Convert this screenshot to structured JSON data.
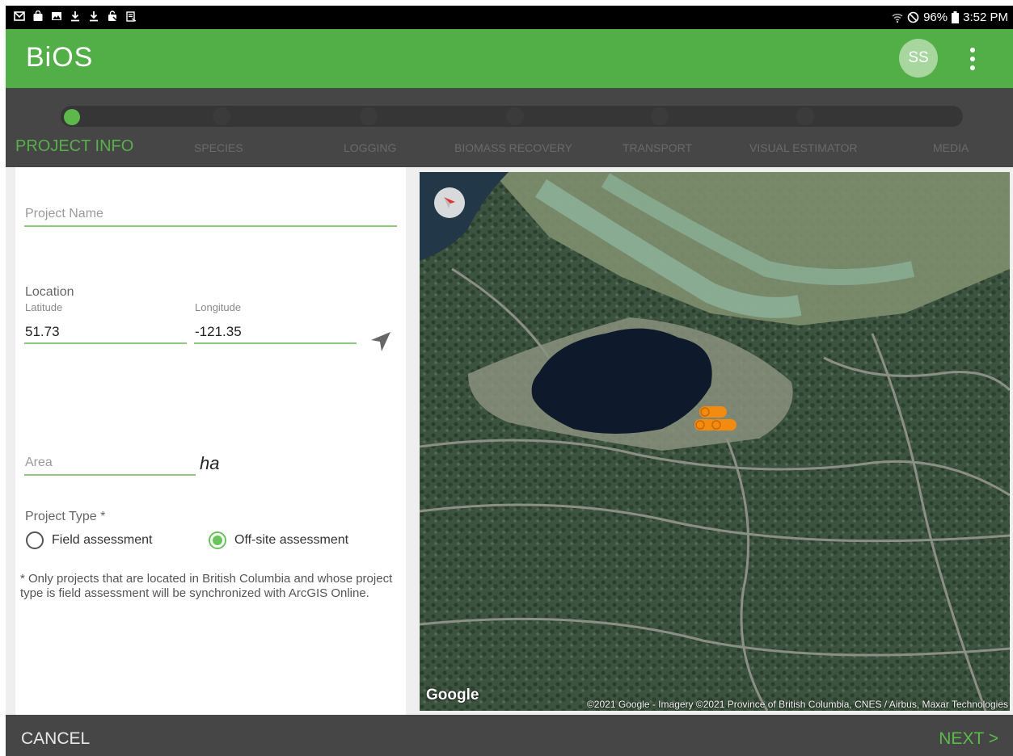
{
  "status_bar": {
    "left_icons": [
      "gmail-icon",
      "shopping-bag-icon",
      "image-icon",
      "download-icon",
      "download-icon",
      "no-sim-icon",
      "clipboard-icon"
    ],
    "battery": "96%",
    "time": "3:52 PM"
  },
  "app_bar": {
    "title": "BiOS",
    "avatar_initials": "SS"
  },
  "stepper": {
    "steps": [
      {
        "label": "PROJECT INFO",
        "active": true
      },
      {
        "label": "SPECIES",
        "active": false
      },
      {
        "label": "LOGGING",
        "active": false
      },
      {
        "label": "BIOMASS RECOVERY",
        "active": false
      },
      {
        "label": "TRANSPORT",
        "active": false
      },
      {
        "label": "VISUAL ESTIMATOR",
        "active": false
      },
      {
        "label": "MEDIA",
        "active": false
      }
    ]
  },
  "form": {
    "project_name_placeholder": "Project Name",
    "location_label": "Location",
    "latitude_label": "Latitude",
    "latitude_value": "51.73",
    "longitude_label": "Longitude",
    "longitude_value": "-121.35",
    "area_placeholder": "Area",
    "area_unit": "ha",
    "project_type_label": "Project Type *",
    "project_type_options": [
      {
        "label": "Field assessment",
        "selected": false
      },
      {
        "label": "Off-site assessment",
        "selected": true
      }
    ],
    "note": "* Only projects that are located in British Columbia and whose project type is field assessment will be synchronized with ArcGIS Online."
  },
  "map": {
    "logo": "Google",
    "attribution": "©2021 Google - Imagery ©2021 Province of British Columbia, CNES / Airbus, Maxar Technologies"
  },
  "bottom_bar": {
    "cancel_label": "CANCEL",
    "next_label": "NEXT >"
  },
  "colors": {
    "primary": "#52ae47",
    "accent": "#5bbb4a",
    "dark_bar": "#464646"
  }
}
